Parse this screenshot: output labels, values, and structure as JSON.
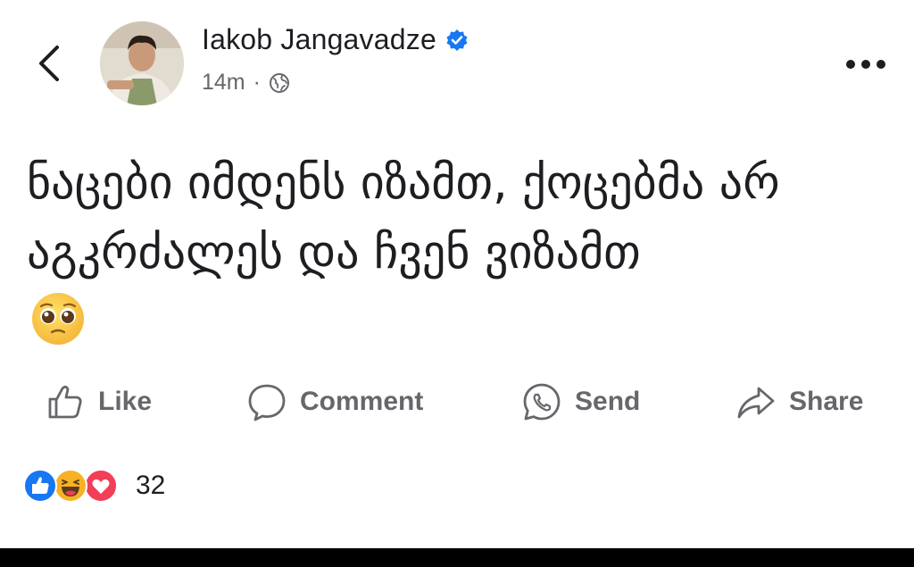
{
  "header": {
    "author_name": "Iakob Jangavadze",
    "timestamp": "14m",
    "separator": "·",
    "privacy_icon": "globe-icon",
    "verified_icon": "verified-badge-icon",
    "back_icon": "chevron-left-icon",
    "more_icon": "more-dots-icon"
  },
  "post": {
    "text": "ნაცები იმდენს იზამთ, ქოცებმა არ აგკრძალეს და ჩვენ ვიზამთ",
    "emoji": "🥹"
  },
  "actions": [
    {
      "label": "Like",
      "icon": "thumbs-up-icon"
    },
    {
      "label": "Comment",
      "icon": "comment-bubble-icon"
    },
    {
      "label": "Send",
      "icon": "whatsapp-icon"
    },
    {
      "label": "Share",
      "icon": "share-arrow-icon"
    }
  ],
  "reactions": {
    "icons": [
      "like-reaction-icon",
      "haha-reaction-icon",
      "love-reaction-icon"
    ],
    "count": "32"
  },
  "colors": {
    "text_primary": "#1c1e21",
    "text_secondary": "#65676b",
    "verified_blue": "#1877f2",
    "like_blue": "#1877f2",
    "love_red": "#f33e58",
    "haha_yellow": "#f7b125"
  }
}
